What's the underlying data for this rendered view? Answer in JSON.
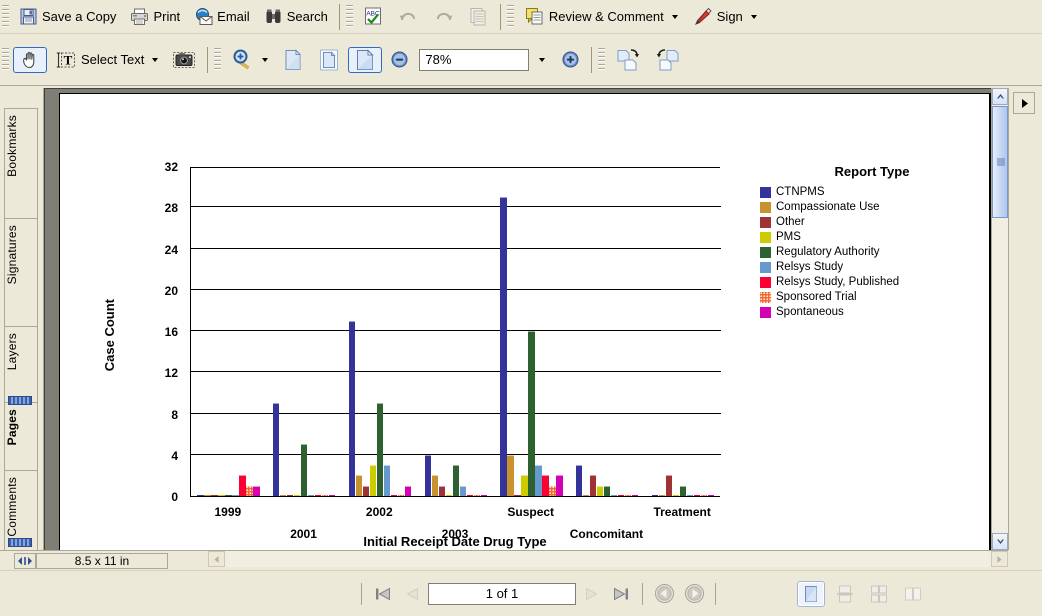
{
  "toolbar_top": {
    "items": [
      {
        "name": "save-a-copy-button",
        "label": "Save a Copy",
        "icon": "floppy-disk-icon",
        "caret": false,
        "disabled": false
      },
      {
        "name": "print-button",
        "label": "Print",
        "icon": "printer-icon",
        "caret": false,
        "disabled": false
      },
      {
        "name": "email-button",
        "label": "Email",
        "icon": "email-icon",
        "caret": false,
        "disabled": false
      },
      {
        "name": "search-button",
        "label": "Search",
        "icon": "binoculars-icon",
        "caret": false,
        "disabled": false
      },
      {
        "name": "spell-check-button",
        "label": "",
        "icon": "spell-check-icon",
        "caret": false,
        "disabled": false
      },
      {
        "name": "undo-button",
        "label": "",
        "icon": "undo-arrow-icon",
        "caret": false,
        "disabled": true
      },
      {
        "name": "redo-button",
        "label": "",
        "icon": "redo-arrow-icon",
        "caret": false,
        "disabled": true
      },
      {
        "name": "copy-button",
        "label": "",
        "icon": "copy-pages-icon",
        "caret": false,
        "disabled": true
      },
      {
        "name": "review-and-comment-button",
        "label": "Review & Comment",
        "icon": "comment-note-icon",
        "caret": true,
        "disabled": false
      },
      {
        "name": "sign-button",
        "label": "Sign",
        "icon": "pen-icon",
        "caret": true,
        "disabled": false
      }
    ]
  },
  "toolbar_second": {
    "hand_tool": {
      "name": "hand-tool-button",
      "icon": "hand-icon"
    },
    "select_text": {
      "name": "select-text-button",
      "label": "Select Text",
      "icon": "text-select-icon",
      "caret": true
    },
    "snapshot": {
      "name": "snapshot-tool-button",
      "icon": "camera-icon"
    },
    "zoom_tool": {
      "name": "zoom-in-tool-button",
      "icon": "magnifier-icon",
      "caret": true
    },
    "page_views": [
      {
        "name": "actual-size-button",
        "icon": "page-plain-icon",
        "pressed": false
      },
      {
        "name": "fit-page-button",
        "icon": "page-fit-icon",
        "pressed": false
      },
      {
        "name": "fit-width-button",
        "icon": "page-width-icon",
        "pressed": true
      }
    ],
    "zoom_out": {
      "name": "zoom-out-button",
      "icon": "minus-circle-icon"
    },
    "zoom_value": "78%",
    "zoom_dropdown": {
      "name": "zoom-level-dropdown",
      "icon": "chevron-down-icon"
    },
    "zoom_in": {
      "name": "zoom-in-button",
      "icon": "plus-circle-icon"
    },
    "rotate_cw": {
      "name": "rotate-clockwise-button",
      "icon": "rotate-cw-icon"
    },
    "rotate_ccw": {
      "name": "rotate-counterclockwise-button",
      "icon": "rotate-ccw-icon"
    }
  },
  "left_nav": {
    "tabs": [
      {
        "name": "sidebar-tab-bookmarks",
        "label": "Bookmarks",
        "selected": false
      },
      {
        "name": "sidebar-tab-signatures",
        "label": "Signatures",
        "selected": false
      },
      {
        "name": "sidebar-tab-layers",
        "label": "Layers",
        "selected": false
      },
      {
        "name": "sidebar-tab-pages",
        "label": "Pages",
        "selected": true
      },
      {
        "name": "sidebar-tab-comments",
        "label": "Comments",
        "selected": false
      }
    ]
  },
  "status_bar": {
    "page_size": "8.5 x 11 in",
    "resize_handle_icon": "resize-horizontal-icon"
  },
  "bottom_bar": {
    "first_page": {
      "name": "first-page-button",
      "icon": "first-page-icon",
      "disabled": false
    },
    "prev_page": {
      "name": "previous-page-button",
      "icon": "previous-page-icon",
      "disabled": true
    },
    "page_indicator": "1 of 1",
    "next_page": {
      "name": "next-page-button",
      "icon": "next-page-icon",
      "disabled": true
    },
    "last_page": {
      "name": "last-page-button",
      "icon": "last-page-icon",
      "disabled": false
    },
    "go_back": {
      "name": "go-back-button",
      "icon": "back-circle-icon"
    },
    "go_forward": {
      "name": "go-forward-button",
      "icon": "forward-circle-icon"
    },
    "view_modes": [
      {
        "name": "single-page-view-button",
        "icon": "single-page-icon",
        "pressed": true
      },
      {
        "name": "continuous-view-button",
        "icon": "continuous-page-icon",
        "pressed": false
      },
      {
        "name": "continuous-facing-view-button",
        "icon": "continuous-facing-icon",
        "pressed": false
      },
      {
        "name": "facing-view-button",
        "icon": "facing-page-icon",
        "pressed": false
      }
    ]
  },
  "chart_data": {
    "type": "bar",
    "title": "",
    "xlabel": "Initial Receipt Date   Drug Type",
    "ylabel": "Case Count",
    "ylim": [
      0,
      32
    ],
    "yticks": [
      0,
      4,
      8,
      12,
      16,
      20,
      24,
      28,
      32
    ],
    "grid": true,
    "legend_title": "Report Type",
    "legend_position": "right",
    "categories": [
      "1999",
      "2001",
      "2002",
      "2003",
      "Suspect",
      "Concomitant",
      "Treatment"
    ],
    "category_rows": [
      {
        "label": "1999",
        "row": 0
      },
      {
        "label": "2001",
        "row": 1
      },
      {
        "label": "2002",
        "row": 0
      },
      {
        "label": "2003",
        "row": 1
      },
      {
        "label": "Suspect",
        "row": 0
      },
      {
        "label": "Concomitant",
        "row": 1
      },
      {
        "label": "Treatment",
        "row": 0
      }
    ],
    "series": [
      {
        "name": "CTNPMS",
        "color": "#33339a",
        "pattern": "solid",
        "values": [
          0,
          9,
          17,
          4,
          29,
          3,
          0
        ]
      },
      {
        "name": "Compassionate Use",
        "color": "#c8932f",
        "pattern": "solid",
        "values": [
          0,
          0,
          2,
          2,
          4,
          0,
          0
        ]
      },
      {
        "name": "Other",
        "color": "#9e3234",
        "pattern": "solid",
        "values": [
          0,
          0,
          1,
          1,
          0,
          2,
          2
        ]
      },
      {
        "name": "PMS",
        "color": "#cccc00",
        "pattern": "solid",
        "values": [
          0,
          0,
          3,
          0,
          2,
          1,
          0
        ]
      },
      {
        "name": "Regulatory Authority",
        "color": "#2d6130",
        "pattern": "solid",
        "values": [
          0,
          5,
          9,
          3,
          16,
          1,
          1
        ]
      },
      {
        "name": "Relsys Study",
        "color": "#6699cc",
        "pattern": "solid",
        "values": [
          0,
          0,
          3,
          1,
          3,
          0,
          0
        ]
      },
      {
        "name": "Relsys Study, Published",
        "color": "#fa0033",
        "pattern": "solid",
        "values": [
          2,
          0,
          0,
          0,
          2,
          0,
          0
        ]
      },
      {
        "name": "Sponsored Trial",
        "color": "#f4662c",
        "pattern": "dotted",
        "values": [
          1,
          0,
          0,
          0,
          1,
          0,
          0
        ]
      },
      {
        "name": "Spontaneous",
        "color": "#d400b4",
        "pattern": "solid",
        "values": [
          1,
          0,
          1,
          0,
          2,
          0,
          0
        ]
      }
    ]
  }
}
